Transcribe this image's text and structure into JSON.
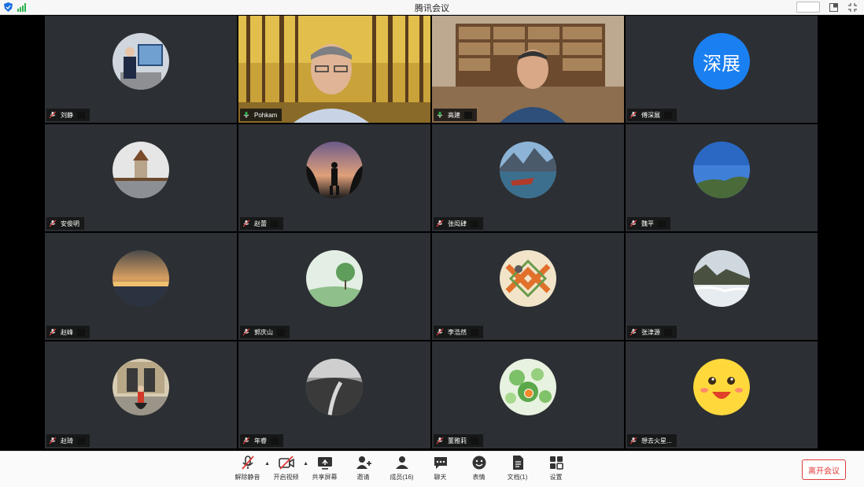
{
  "window": {
    "title": "腾讯会议"
  },
  "participants": [
    {
      "name": "刘静",
      "mic": "muted",
      "avatar": "photo-presenter"
    },
    {
      "name": "Pohkam",
      "mic": "on",
      "avatar": "video-autumn-trees"
    },
    {
      "name": "高建",
      "mic": "on",
      "avatar": "video-bookshelf"
    },
    {
      "name": "傅深展",
      "mic": "muted",
      "avatar": "text-avatar",
      "avatar_text": "深展",
      "avatar_color": "#1a7ff0"
    },
    {
      "name": "安俊明",
      "mic": "muted",
      "avatar": "photo-tower"
    },
    {
      "name": "赵蕾",
      "mic": "muted",
      "avatar": "photo-silhouette-sunset"
    },
    {
      "name": "张闳肆",
      "mic": "muted",
      "avatar": "photo-lake-boat"
    },
    {
      "name": "魏平",
      "mic": "muted",
      "avatar": "photo-blue-sky"
    },
    {
      "name": "赵峰",
      "mic": "muted",
      "avatar": "photo-sunset-river"
    },
    {
      "name": "郭庆山",
      "mic": "muted",
      "avatar": "photo-green-landscape"
    },
    {
      "name": "李浩然",
      "mic": "muted",
      "avatar": "photo-pattern"
    },
    {
      "name": "张津源",
      "mic": "muted",
      "avatar": "photo-mountain-clouds"
    },
    {
      "name": "赵琦",
      "mic": "muted",
      "avatar": "photo-person-building"
    },
    {
      "name": "年睿",
      "mic": "muted",
      "avatar": "photo-road-bw"
    },
    {
      "name": "董雅莉",
      "mic": "muted",
      "avatar": "photo-green-leaves"
    },
    {
      "name": "想去火星...",
      "mic": "muted",
      "avatar": "emoji-face"
    }
  ],
  "toolbar": {
    "unmute": "解除静音",
    "video": "开启视频",
    "share": "共享屏幕",
    "invite": "邀请",
    "members": "成员(16)",
    "chat": "聊天",
    "emoji": "表情",
    "docs": "文档(1)",
    "settings": "设置",
    "leave": "离开会议"
  },
  "colors": {
    "tile_bg": "#2c2f33",
    "leave_red": "#e03a3a",
    "talking_green": "#1ea446"
  }
}
